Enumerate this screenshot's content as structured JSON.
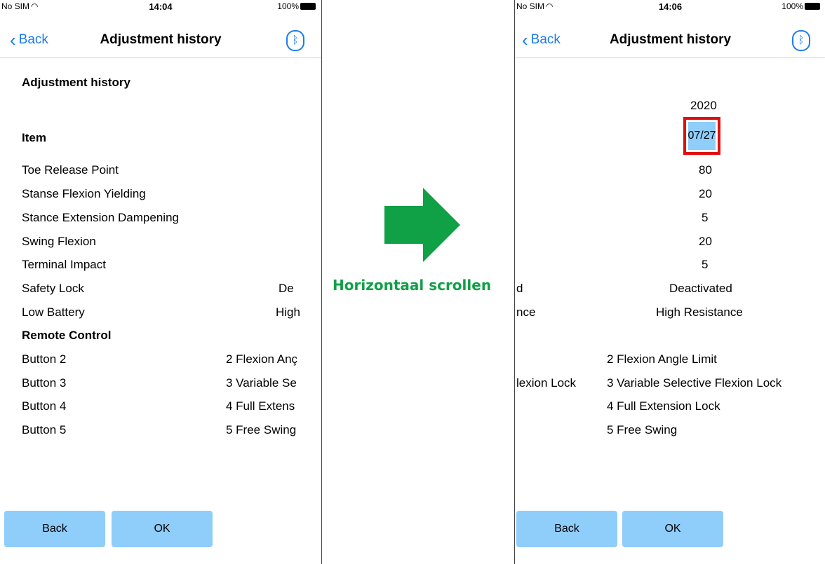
{
  "left": {
    "status": {
      "carrier": "No SIM",
      "time": "14:04",
      "battery": "100%"
    },
    "nav": {
      "back": "Back",
      "title": "Adjustment history"
    },
    "heading": "Adjustment history",
    "item_header": "Item",
    "rows": [
      {
        "label": "Toe Release Point",
        "value": ""
      },
      {
        "label": "Stanse Flexion Yielding",
        "value": ""
      },
      {
        "label": "Stance Extension Dampening",
        "value": ""
      },
      {
        "label": "Swing Flexion",
        "value": ""
      },
      {
        "label": "Terminal Impact",
        "value": ""
      },
      {
        "label": "Safety Lock",
        "value": "De"
      },
      {
        "label": "Low Battery",
        "value": "High"
      }
    ],
    "remote_header": "Remote Control",
    "remote_rows": [
      {
        "label": "Button 2",
        "value": "2 Flexion Anç"
      },
      {
        "label": "Button 3",
        "value": "3 Variable Se"
      },
      {
        "label": "Button 4",
        "value": "4 Full Extens"
      },
      {
        "label": "Button 5",
        "value": "5 Free Swing"
      }
    ],
    "buttons": {
      "back": "Back",
      "ok": "OK"
    }
  },
  "arrow_caption": "Horizontaal scrollen",
  "right": {
    "status": {
      "carrier": "No SIM",
      "time": "14:06",
      "battery": "100%"
    },
    "nav": {
      "back": "Back",
      "title": "Adjustment history"
    },
    "year": "2020",
    "date": "07/27",
    "values": [
      "80",
      "20",
      "5",
      "20",
      "5"
    ],
    "safety_lock_left": "d",
    "safety_lock_value": "Deactivated",
    "low_battery_left": "nce",
    "low_battery_value": "High Resistance",
    "remote": [
      {
        "left": "",
        "value": "2 Flexion Angle Limit"
      },
      {
        "left": "lexion Lock",
        "value": "3 Variable Selective Flexion Lock"
      },
      {
        "left": "",
        "value": "4 Full Extension Lock"
      },
      {
        "left": "",
        "value": "5 Free Swing"
      }
    ],
    "buttons": {
      "back": "Back",
      "ok": "OK"
    }
  },
  "colors": {
    "accent": "#1a7cf0",
    "button": "#8fcdfa",
    "arrow": "#10a046",
    "highlight": "#e01010"
  }
}
